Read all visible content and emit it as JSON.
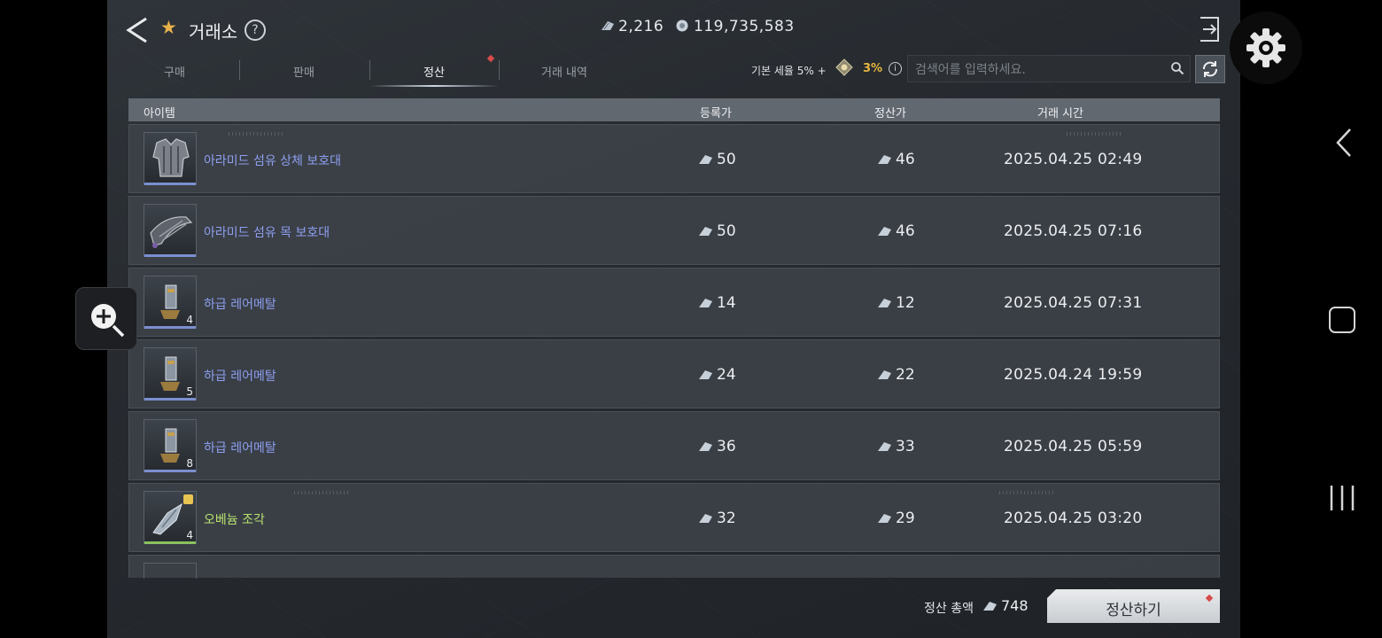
{
  "header": {
    "title": "거래소",
    "currency_gem": "2,216",
    "currency_silver": "119,735,583"
  },
  "tabs": [
    {
      "label": "구매",
      "active": false
    },
    {
      "label": "판매",
      "active": false
    },
    {
      "label": "정산",
      "active": true
    },
    {
      "label": "거래 내역",
      "active": false
    }
  ],
  "tax": {
    "base_label": "기본 세율 5% +",
    "extra_pct": "3%"
  },
  "search": {
    "placeholder": "검색어를 입력하세요.",
    "value": ""
  },
  "table": {
    "columns": [
      "아이템",
      "등록가",
      "정산가",
      "거래 시간"
    ],
    "rows": [
      {
        "name": "아라미드 섬유 상체 보호대",
        "qty": "",
        "listed": "50",
        "settled": "46",
        "time": "2025.04.25 02:49",
        "grade": "blue",
        "icon": "chest-armor-icon"
      },
      {
        "name": "아라미드 섬유 목 보호대",
        "qty": "",
        "listed": "50",
        "settled": "46",
        "time": "2025.04.25 07:16",
        "grade": "blue",
        "icon": "neck-guard-icon"
      },
      {
        "name": "하급 레어메탈",
        "qty": "4",
        "listed": "14",
        "settled": "12",
        "time": "2025.04.25 07:31",
        "grade": "blue",
        "icon": "rare-metal-icon"
      },
      {
        "name": "하급 레어메탈",
        "qty": "5",
        "listed": "24",
        "settled": "22",
        "time": "2025.04.24 19:59",
        "grade": "blue",
        "icon": "rare-metal-icon"
      },
      {
        "name": "하급 레어메탈",
        "qty": "8",
        "listed": "36",
        "settled": "33",
        "time": "2025.04.25 05:59",
        "grade": "blue",
        "icon": "rare-metal-icon"
      },
      {
        "name": "오베늄 조각",
        "qty": "4",
        "listed": "32",
        "settled": "29",
        "time": "2025.04.25 03:20",
        "grade": "green",
        "icon": "obenium-shard-icon"
      }
    ]
  },
  "footer": {
    "total_label": "정산 총액",
    "total_value": "748",
    "settle_button": "정산하기"
  },
  "colors": {
    "grade_blue": "#8d9ff0",
    "grade_green": "#b8e36d",
    "tax_highlight": "#e7b640",
    "alert_dot": "#d84b4b"
  }
}
